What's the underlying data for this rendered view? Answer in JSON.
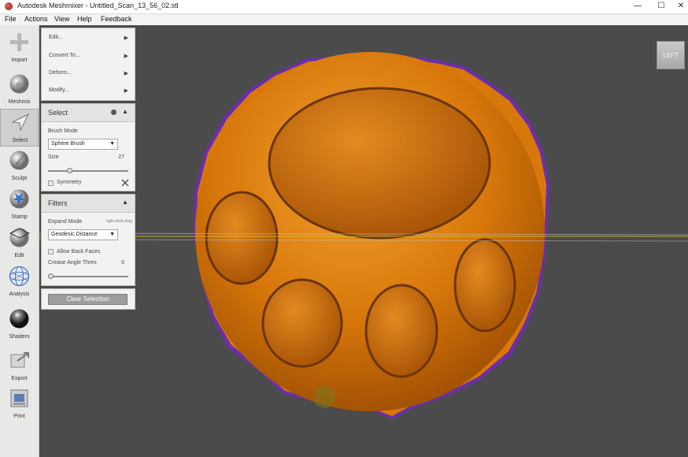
{
  "window": {
    "title": "Autodesk Meshmixer - Untitled_Scan_13_56_02.stl",
    "minimize_glyph": "—",
    "maximize_glyph": "☐",
    "close_glyph": "✕"
  },
  "menu": {
    "items": [
      "File",
      "Actions",
      "View",
      "Help",
      "Feedback"
    ]
  },
  "toolbar": {
    "items": [
      {
        "label": "Import",
        "icon": "plus-icon"
      },
      {
        "label": "Meshmix",
        "icon": "sphere-mix-icon"
      },
      {
        "label": "Select",
        "icon": "arrow-cursor-icon"
      },
      {
        "label": "Sculpt",
        "icon": "brush-sphere-icon"
      },
      {
        "label": "Stamp",
        "icon": "stamp-sphere-icon"
      },
      {
        "label": "Edit",
        "icon": "edit-sphere-icon"
      },
      {
        "label": "Analysis",
        "icon": "wireframe-sphere-icon"
      },
      {
        "label": "Shaders",
        "icon": "shader-ball-icon"
      },
      {
        "label": "Export",
        "icon": "export-icon"
      },
      {
        "label": "Print",
        "icon": "printer-icon"
      }
    ],
    "active": "Select"
  },
  "actions_panel": {
    "items": [
      "Edit...",
      "Convert To...",
      "Deform...",
      "Modify..."
    ],
    "arrow": "▶"
  },
  "select_panel": {
    "title": "Select",
    "brush_mode_label": "Brush Mode",
    "brush_mode_value": "Sphere Brush",
    "size_label": "Size",
    "size_value": "27",
    "size_fraction": 0.27,
    "symmetry_label": "Symmetry",
    "collapse_glyph": "▲",
    "dropdown_caret": "▼"
  },
  "filters_panel": {
    "title": "Filters",
    "expand_mode_label": "Expand Mode",
    "expand_mode_hint": "right-click-drag",
    "expand_mode_value": "Geodesic Distance",
    "allow_back_faces_label": "Allow Back Faces",
    "crease_angle_label": "Crease Angle Thres",
    "crease_angle_value": "0",
    "crease_fraction": 0.0,
    "collapse_glyph": "▲"
  },
  "clear_selection_label": "Clear Selection",
  "viewcube": {
    "label": "LEFT"
  },
  "colors": {
    "viewport_bg": "#4b4b4b",
    "mesh_orange": "#d9780a",
    "selection_outline": "#6a2fa8"
  }
}
